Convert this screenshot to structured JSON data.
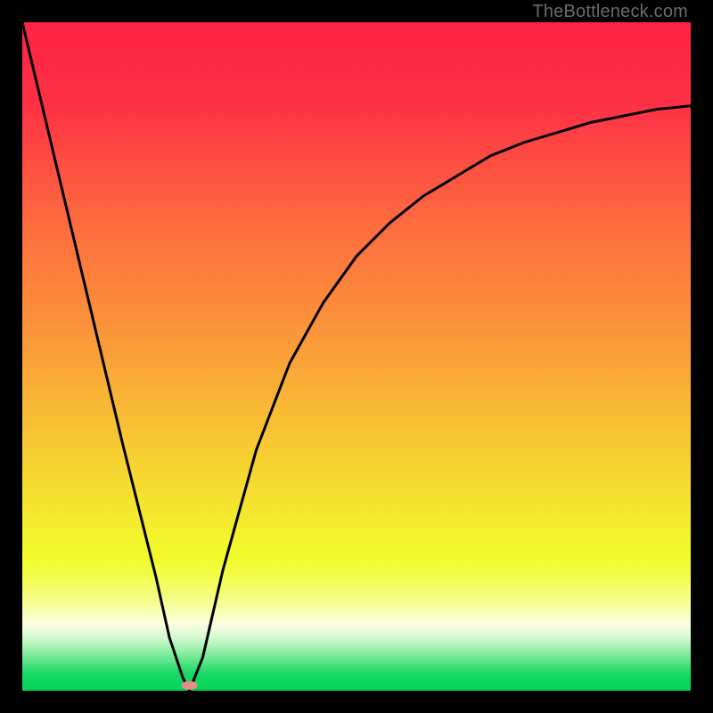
{
  "watermark": "TheBottleneck.com",
  "chart_data": {
    "type": "line",
    "title": "",
    "xlabel": "",
    "ylabel": "",
    "xlim": [
      0,
      100
    ],
    "ylim": [
      0,
      100
    ],
    "grid": false,
    "legend": false,
    "series": [
      {
        "name": "bottleneck-curve",
        "x": [
          0,
          5,
          10,
          15,
          18,
          20,
          22,
          24,
          25,
          27,
          30,
          35,
          40,
          45,
          50,
          55,
          60,
          65,
          70,
          75,
          80,
          85,
          90,
          95,
          100
        ],
        "values": [
          100,
          79,
          58,
          37,
          25,
          17,
          8,
          2,
          0,
          5,
          18,
          36,
          49,
          58,
          65,
          70,
          74,
          77,
          80,
          82,
          83.5,
          85,
          86,
          87,
          87.5
        ]
      }
    ],
    "marker": {
      "x": 25,
      "y": 0.8,
      "color": "#e88b87",
      "rx": 9,
      "ry": 5
    },
    "gradient_stops": [
      {
        "offset": 0.0,
        "color": "#fe2345"
      },
      {
        "offset": 0.12,
        "color": "#fe3045"
      },
      {
        "offset": 0.3,
        "color": "#fd6b3f"
      },
      {
        "offset": 0.45,
        "color": "#fb923a"
      },
      {
        "offset": 0.6,
        "color": "#f8c034"
      },
      {
        "offset": 0.73,
        "color": "#f4e72e"
      },
      {
        "offset": 0.8,
        "color": "#f2fb2b"
      },
      {
        "offset": 0.83,
        "color": "#f3fd4b"
      },
      {
        "offset": 0.87,
        "color": "#f6fe95"
      },
      {
        "offset": 0.9,
        "color": "#fbfee2"
      },
      {
        "offset": 0.92,
        "color": "#d6fad0"
      },
      {
        "offset": 0.94,
        "color": "#94efa9"
      },
      {
        "offset": 0.96,
        "color": "#4de281"
      },
      {
        "offset": 0.975,
        "color": "#17d864"
      },
      {
        "offset": 1.0,
        "color": "#03d358"
      }
    ]
  }
}
